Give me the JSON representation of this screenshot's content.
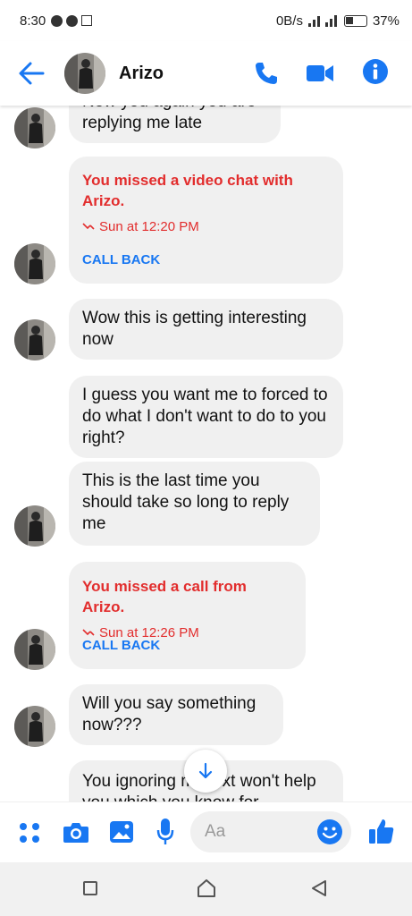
{
  "status_bar": {
    "time": "8:30",
    "network_speed": "0B/s",
    "battery": "37%"
  },
  "header": {
    "contact_name": "Arizo",
    "back_icon": "arrow-left-icon",
    "call_icon": "phone-icon",
    "video_icon": "video-camera-icon",
    "info_icon": "info-icon"
  },
  "messages": {
    "m0": "Now you again you are replying me late",
    "m1": {
      "title": "You missed a video chat with Arizo.",
      "time": "Sun at 12:20 PM",
      "action": "CALL BACK"
    },
    "m2": "Wow this is getting interesting now",
    "m3": "I guess you want me to forced to do what I don't want to do to you right?",
    "m4": "This is the last time you should take so long to reply me",
    "m5": {
      "title": "You missed a call from Arizo.",
      "time": "Sun at 12:26 PM",
      "action": "CALL BACK"
    },
    "m6": "Will you say something now???",
    "m7": "You ignoring my text won't help you which you know for"
  },
  "composer": {
    "placeholder": "Aa"
  },
  "colors": {
    "accent": "#1877f2",
    "missed": "#e22d2d",
    "bubble": "#f0f0f0"
  }
}
